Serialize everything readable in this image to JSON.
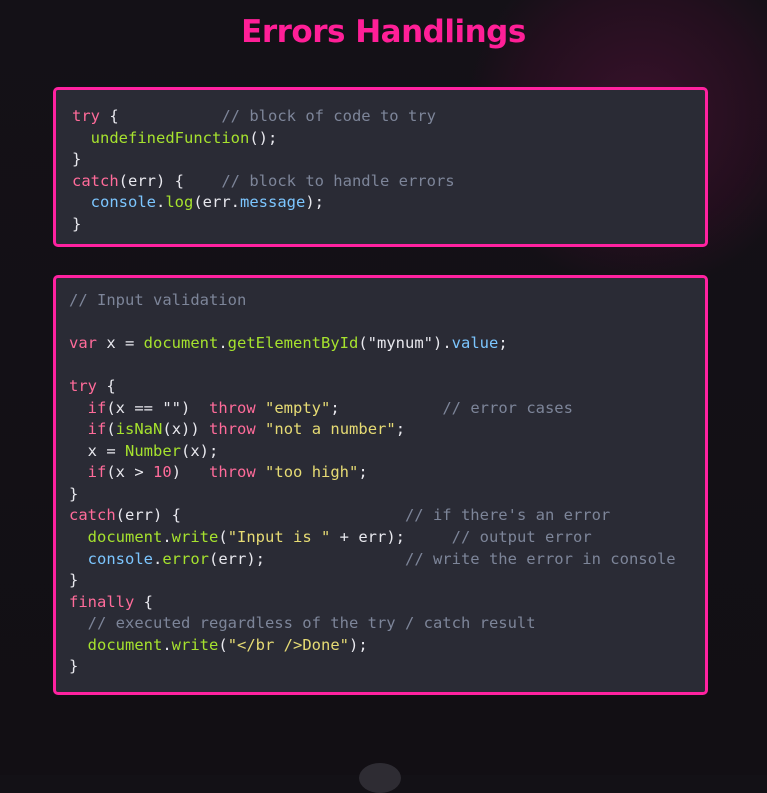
{
  "title": "Errors Handlings",
  "colors": {
    "accent": "#ff1f97",
    "card_border": "#ff22a0",
    "card_background": "#2a2b35",
    "page_background": "#131116",
    "keyword": "#ff6b9a",
    "function": "#a6e22e",
    "property": "#7cc6ff",
    "string": "#e6db74",
    "comment": "#7d8599",
    "text": "#e8e8ee"
  },
  "code_blocks": [
    {
      "language": "javascript",
      "lines": [
        [
          {
            "t": "kw",
            "v": "try"
          },
          {
            "t": "txt",
            "v": " {           "
          },
          {
            "t": "cm",
            "v": "// block of code to try"
          }
        ],
        [
          {
            "t": "txt",
            "v": "  "
          },
          {
            "t": "fn",
            "v": "undefinedFunction"
          },
          {
            "t": "txt",
            "v": "();"
          }
        ],
        [
          {
            "t": "txt",
            "v": "}"
          }
        ],
        [
          {
            "t": "kw",
            "v": "catch"
          },
          {
            "t": "txt",
            "v": "(err) {    "
          },
          {
            "t": "cm",
            "v": "// block to handle errors"
          }
        ],
        [
          {
            "t": "txt",
            "v": "  "
          },
          {
            "t": "prop",
            "v": "console"
          },
          {
            "t": "txt",
            "v": "."
          },
          {
            "t": "fn",
            "v": "log"
          },
          {
            "t": "txt",
            "v": "(err."
          },
          {
            "t": "prop",
            "v": "message"
          },
          {
            "t": "txt",
            "v": ");"
          }
        ],
        [
          {
            "t": "txt",
            "v": "}"
          }
        ]
      ]
    },
    {
      "language": "javascript",
      "lines": [
        [
          {
            "t": "cm",
            "v": "// Input validation"
          }
        ],
        [
          {
            "t": "txt",
            "v": ""
          }
        ],
        [
          {
            "t": "kw",
            "v": "var"
          },
          {
            "t": "txt",
            "v": " x = "
          },
          {
            "t": "fn",
            "v": "document"
          },
          {
            "t": "txt",
            "v": "."
          },
          {
            "t": "fn",
            "v": "getElementById"
          },
          {
            "t": "txt",
            "v": "("
          },
          {
            "t": "txt",
            "v": "\"mynum\""
          },
          {
            "t": "txt",
            "v": ")."
          },
          {
            "t": "prop",
            "v": "value"
          },
          {
            "t": "txt",
            "v": ";"
          }
        ],
        [
          {
            "t": "txt",
            "v": ""
          }
        ],
        [
          {
            "t": "kw",
            "v": "try"
          },
          {
            "t": "txt",
            "v": " {"
          }
        ],
        [
          {
            "t": "txt",
            "v": "  "
          },
          {
            "t": "kw",
            "v": "if"
          },
          {
            "t": "txt",
            "v": "(x == \"\")  "
          },
          {
            "t": "kw",
            "v": "throw"
          },
          {
            "t": "txt",
            "v": " "
          },
          {
            "t": "str",
            "v": "\"empty\""
          },
          {
            "t": "txt",
            "v": ";           "
          },
          {
            "t": "cm",
            "v": "// error cases"
          }
        ],
        [
          {
            "t": "txt",
            "v": "  "
          },
          {
            "t": "kw",
            "v": "if"
          },
          {
            "t": "txt",
            "v": "("
          },
          {
            "t": "fn",
            "v": "isNaN"
          },
          {
            "t": "txt",
            "v": "(x)) "
          },
          {
            "t": "kw",
            "v": "throw"
          },
          {
            "t": "txt",
            "v": " "
          },
          {
            "t": "str",
            "v": "\"not a number\""
          },
          {
            "t": "txt",
            "v": ";"
          }
        ],
        [
          {
            "t": "txt",
            "v": "  x = "
          },
          {
            "t": "fn",
            "v": "Number"
          },
          {
            "t": "txt",
            "v": "(x);"
          }
        ],
        [
          {
            "t": "txt",
            "v": "  "
          },
          {
            "t": "kw",
            "v": "if"
          },
          {
            "t": "txt",
            "v": "(x > "
          },
          {
            "t": "num",
            "v": "10"
          },
          {
            "t": "txt",
            "v": ")   "
          },
          {
            "t": "kw",
            "v": "throw"
          },
          {
            "t": "txt",
            "v": " "
          },
          {
            "t": "str",
            "v": "\"too high\""
          },
          {
            "t": "txt",
            "v": ";"
          }
        ],
        [
          {
            "t": "txt",
            "v": "}"
          }
        ],
        [
          {
            "t": "kw",
            "v": "catch"
          },
          {
            "t": "txt",
            "v": "(err) {                        "
          },
          {
            "t": "cm",
            "v": "// if there's an error"
          }
        ],
        [
          {
            "t": "txt",
            "v": "  "
          },
          {
            "t": "fn",
            "v": "document"
          },
          {
            "t": "txt",
            "v": "."
          },
          {
            "t": "fn",
            "v": "write"
          },
          {
            "t": "txt",
            "v": "("
          },
          {
            "t": "str",
            "v": "\"Input is \""
          },
          {
            "t": "txt",
            "v": " + err);     "
          },
          {
            "t": "cm",
            "v": "// output error"
          }
        ],
        [
          {
            "t": "txt",
            "v": "  "
          },
          {
            "t": "prop",
            "v": "console"
          },
          {
            "t": "txt",
            "v": "."
          },
          {
            "t": "fn",
            "v": "error"
          },
          {
            "t": "txt",
            "v": "(err);               "
          },
          {
            "t": "cm",
            "v": "// write the error in console"
          }
        ],
        [
          {
            "t": "txt",
            "v": "}"
          }
        ],
        [
          {
            "t": "kw",
            "v": "finally"
          },
          {
            "t": "txt",
            "v": " {"
          }
        ],
        [
          {
            "t": "txt",
            "v": "  "
          },
          {
            "t": "cm",
            "v": "// executed regardless of the try / catch result"
          }
        ],
        [
          {
            "t": "txt",
            "v": "  "
          },
          {
            "t": "fn",
            "v": "document"
          },
          {
            "t": "txt",
            "v": "."
          },
          {
            "t": "fn",
            "v": "write"
          },
          {
            "t": "txt",
            "v": "("
          },
          {
            "t": "str",
            "v": "\"</br />Done\""
          },
          {
            "t": "txt",
            "v": ");"
          }
        ],
        [
          {
            "t": "txt",
            "v": "}"
          }
        ]
      ]
    }
  ]
}
